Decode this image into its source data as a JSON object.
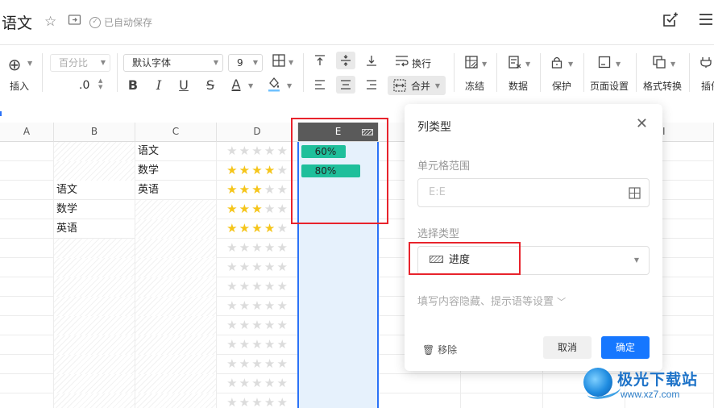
{
  "titlebar": {
    "doc_title": "语文",
    "autosave": "已自动保存",
    "icons": [
      "star-icon",
      "move-to-folder-icon",
      "check-circle-icon",
      "share-edit-icon",
      "menu-icon"
    ]
  },
  "toolbar": {
    "insert_label": "插入",
    "number_format": "百分比",
    "decimal": ".0",
    "font_family": "默认字体",
    "font_size": "9",
    "wrap_label": "换行",
    "merge_label": "合并",
    "freeze_label": "冻结",
    "data_label": "数据",
    "protect_label": "保护",
    "page_setup_label": "页面设置",
    "format_convert_label": "格式转换",
    "plugin_label": "插件"
  },
  "grid": {
    "columns": [
      "A",
      "B",
      "C",
      "D",
      "E",
      "I"
    ],
    "rows": [
      {
        "b": "",
        "c": "语文",
        "stars": 0,
        "progress": "60%",
        "progress_fraction": 0.6
      },
      {
        "b": "",
        "c": "数学",
        "stars": 4,
        "progress": "80%",
        "progress_fraction": 0.8
      },
      {
        "b": "语文",
        "c": "英语",
        "stars": 3
      },
      {
        "b": "数学",
        "c": "",
        "stars": 3
      },
      {
        "b": "英语",
        "c": "",
        "stars": 4
      },
      {
        "stars": 0
      },
      {
        "stars": 0
      },
      {
        "stars": 0
      },
      {
        "stars": 0
      },
      {
        "stars": 0
      },
      {
        "stars": 0
      },
      {
        "stars": 0
      },
      {
        "stars": 0
      },
      {
        "stars": 0
      }
    ]
  },
  "panel": {
    "title": "列类型",
    "range_label": "单元格范围",
    "range_placeholder": "E:E",
    "type_label": "选择类型",
    "type_value": "进度",
    "more_settings": "填写内容隐藏、提示语等设置",
    "remove_label": "移除",
    "cancel_label": "取消",
    "ok_label": "确定"
  },
  "watermark": {
    "name": "极光下载站",
    "url": "www.xz7.com"
  },
  "colors": {
    "accent": "#1677ff",
    "progress": "#1fbf9b",
    "star": "#f5c51a",
    "highlight": "#e8232c"
  }
}
